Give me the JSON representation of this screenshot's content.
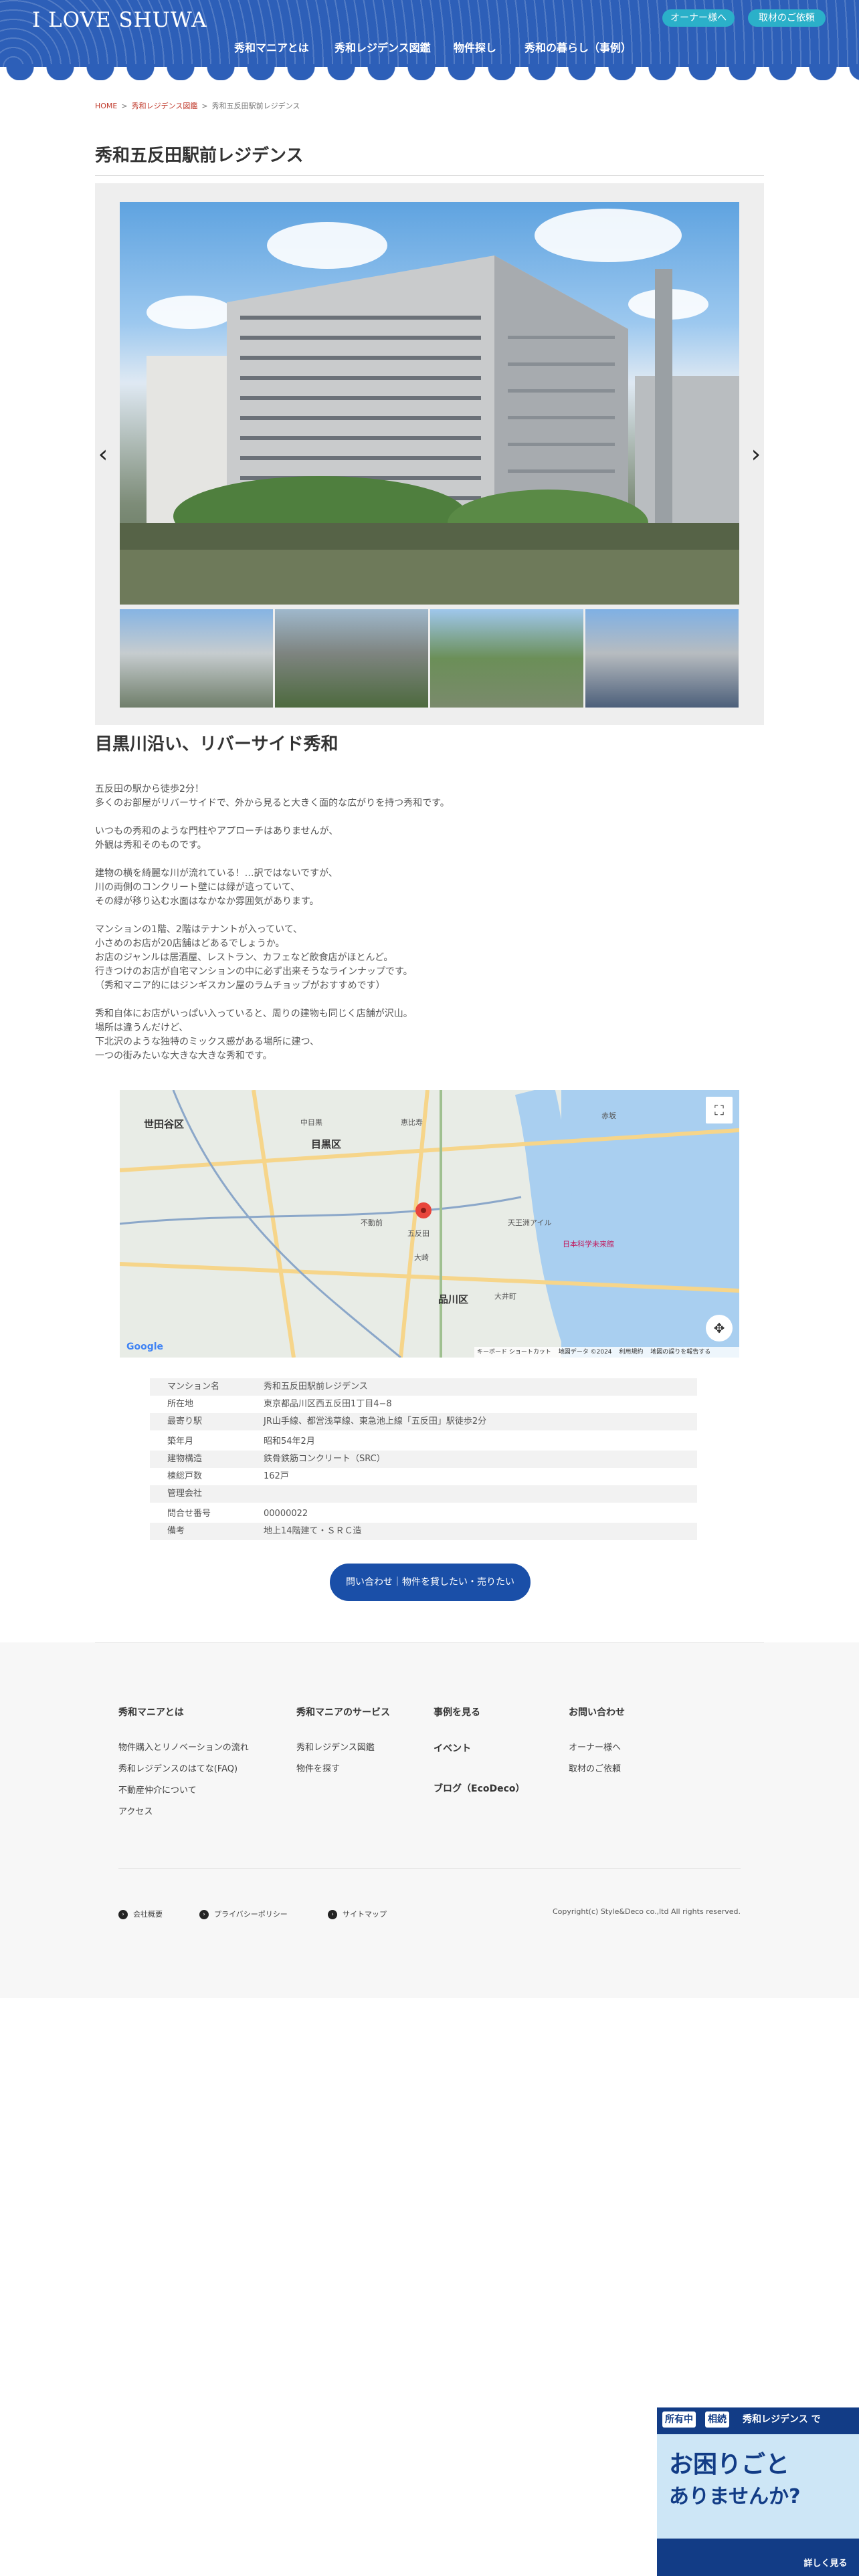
{
  "header": {
    "logo_text": "I LOVE SHUWA",
    "top_buttons": [
      "オーナー様へ",
      "取材のご依頼"
    ],
    "nav": [
      "秀和マニアとは",
      "秀和レジデンス図鑑",
      "物件探し",
      "秀和の暮らし（事例）"
    ]
  },
  "breadcrumb": {
    "home": "HOME",
    "category": "秀和レジデンス図鑑",
    "current": "秀和五反田駅前レジデンス"
  },
  "page_title": "秀和五反田駅前レジデンス",
  "gallery": {
    "prev": "‹",
    "next": "›"
  },
  "section_title": "目黒川沿い、リバーサイド秀和",
  "description": [
    [
      "五反田の駅から徒歩2分！",
      "多くのお部屋がリバーサイドで、外から見ると大きく面的な広がりを持つ秀和です。"
    ],
    [
      "いつもの秀和のような門柱やアプローチはありませんが、",
      "外観は秀和そのものです。"
    ],
    [
      "建物の横を綺麗な川が流れている！…訳ではないですが、",
      "川の両側のコンクリート壁には緑が這っていて、",
      "その緑が移り込む水面はなかなか雰囲気があります。"
    ],
    [
      "マンションの1階、2階はテナントが入っていて、",
      "小さめのお店が20店舗はどあるでしょうか。",
      "お店のジャンルは居酒屋、レストラン、カフェなど飲食店がほとんど。",
      "行きつけのお店が自宅マンションの中に必ず出来そうなラインナップです。",
      "（秀和マニア的にはジンギスカン屋のラムチョップがおすすめです）"
    ],
    [
      "秀和自体にお店がいっぱい入っていると、周りの建物も同じく店舗が沢山。",
      "場所は違うんだけど、",
      "下北沢のような独特のミックス感がある場所に建つ、",
      "一つの街みたいな大きな大きな秀和です。"
    ]
  ],
  "map": {
    "labels": [
      "世田谷区",
      "目黒区",
      "品川区",
      "日本科学未来館",
      "五反田",
      "大崎",
      "不動前",
      "恵比寿",
      "中目黒",
      "大井町",
      "天王洲アイル",
      "赤坂"
    ],
    "footer_labels": [
      "キーボード ショートカット",
      "地図データ ©2024",
      "利用規約",
      "地図の誤りを報告する"
    ],
    "google_label": "Google"
  },
  "info": [
    {
      "k": "マンション名",
      "v": "秀和五反田駅前レジデンス"
    },
    {
      "k": "所在地",
      "v": "東京都品川区西五反田1丁目4−8"
    },
    {
      "k": "最寄り駅",
      "v": "JR山手線、都営浅草線、東急池上線「五反田」駅徒歩2分"
    },
    {
      "k": "築年月",
      "v": "昭和54年2月"
    },
    {
      "k": "建物構造",
      "v": "鉄骨鉄筋コンクリート（SRC）"
    },
    {
      "k": "棟総戸数",
      "v": "162戸"
    },
    {
      "k": "管理会社",
      "v": ""
    },
    {
      "k": "問合せ番号",
      "v": "00000022"
    },
    {
      "k": "備考",
      "v": "地上14階建て・ＳＲＣ造"
    }
  ],
  "cta_label": "問い合わせ｜物件を貸したい・売りたい",
  "footer": {
    "col1_head": "秀和マニアとは",
    "col1_links": [
      "物件購入とリノベーションの流れ",
      "秀和レジデンスのはてな(FAQ)",
      "不動産仲介について",
      "アクセス"
    ],
    "col2_head": "秀和マニアのサービス",
    "col2_links": [
      "秀和レジデンス図鑑",
      "物件を探す"
    ],
    "col3_head": "事例を見る",
    "col3_links": [
      "イベント",
      "ブログ（EcoDeco）"
    ],
    "col4_head": "お問い合わせ",
    "col4_links": [
      "オーナー様へ",
      "取材のご依頼"
    ],
    "bottom_links": [
      "会社概要",
      "プライバシーポリシー",
      "サイトマップ"
    ],
    "copyright": "Copyright(c) Style&Deco co.,ltd All rights reserved."
  },
  "ad": {
    "tag1": "所有中",
    "tag2": "相続",
    "headline1": "秀和レジデンス で",
    "big1": "お困りごと",
    "big2": "ありませんか?",
    "button": "詳しく見る"
  }
}
